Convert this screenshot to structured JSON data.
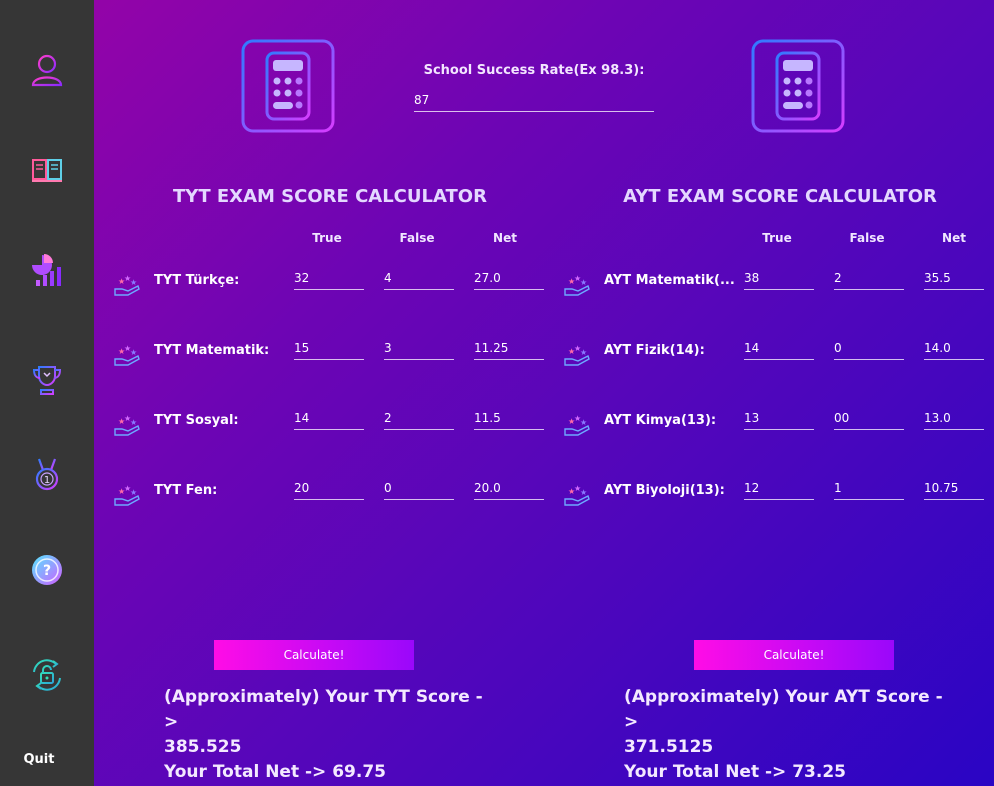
{
  "sidebar": {
    "items": [
      {
        "icon": "user-icon"
      },
      {
        "icon": "book-icon"
      },
      {
        "icon": "chart-icon"
      },
      {
        "icon": "trophy-icon"
      },
      {
        "icon": "medal-icon"
      },
      {
        "icon": "help-icon"
      },
      {
        "icon": "lock-icon"
      }
    ],
    "quit_label": "Quit"
  },
  "school": {
    "label": "School Success Rate(Ex 98.3):",
    "value": "87"
  },
  "tyt": {
    "title": "TYT EXAM SCORE CALCULATOR",
    "columns": {
      "true": "True",
      "false": "False",
      "net": "Net"
    },
    "rows": [
      {
        "label": "TYT Türkçe:",
        "true": "32",
        "false": "4",
        "net": "27.0"
      },
      {
        "label": "TYT Matematik:",
        "true": "15",
        "false": "3",
        "net": "11.25"
      },
      {
        "label": "TYT Sosyal:",
        "true": "14",
        "false": "2",
        "net": "11.5"
      },
      {
        "label": "TYT Fen:",
        "true": "20",
        "false": "0",
        "net": "20.0"
      }
    ],
    "button": "Calculate!",
    "score_line1": "(Approximately) Your TYT Score ->",
    "score_value": "385.525",
    "net_line": "Your Total Net -> 69.75"
  },
  "ayt": {
    "title": "AYT EXAM SCORE CALCULATOR",
    "columns": {
      "true": "True",
      "false": "False",
      "net": "Net"
    },
    "rows": [
      {
        "label": "AYT Matematik(...",
        "true": "38",
        "false": "2",
        "net": "35.5"
      },
      {
        "label": "AYT Fizik(14):",
        "true": "14",
        "false": "0",
        "net": "14.0"
      },
      {
        "label": "AYT Kimya(13):",
        "true": "13",
        "false": "00",
        "net": "13.0"
      },
      {
        "label": "AYT Biyoloji(13):",
        "true": "12",
        "false": "1",
        "net": "10.75"
      }
    ],
    "button": "Calculate!",
    "score_line1": "(Approximately) Your AYT Score ->",
    "score_value": "371.5125",
    "net_line": "Your Total Net -> 73.25"
  },
  "colors": {
    "sidebar": "#363636",
    "accent_pink": "#ff0ce6",
    "accent_purple": "#9a07fb"
  }
}
